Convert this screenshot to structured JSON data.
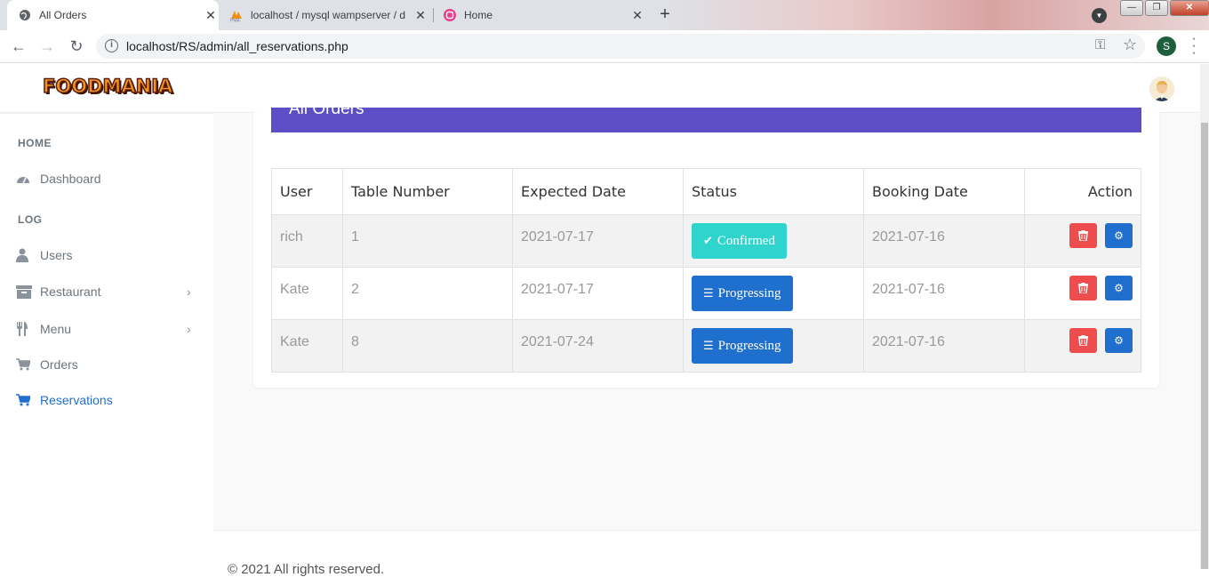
{
  "browser": {
    "tabs": [
      {
        "title": "All Orders",
        "active": true
      },
      {
        "title": "localhost / mysql wampserver / d",
        "active": false
      },
      {
        "title": "Home",
        "active": false
      }
    ],
    "url": "localhost/RS/admin/all_reservations.php",
    "profile_initial": "S"
  },
  "header": {
    "logo": "FOODMANIA"
  },
  "sidebar": {
    "sections": [
      "HOME",
      "LOG"
    ],
    "items": [
      {
        "label": "Dashboard",
        "icon": "dashboard-icon"
      },
      {
        "label": "Users",
        "icon": "user-icon"
      },
      {
        "label": "Restaurant",
        "icon": "archive-icon",
        "has_submenu": true
      },
      {
        "label": "Menu",
        "icon": "cutlery-icon",
        "has_submenu": true
      },
      {
        "label": "Orders",
        "icon": "cart-icon"
      },
      {
        "label": "Reservations",
        "icon": "cart-icon",
        "active": true
      }
    ]
  },
  "main": {
    "card_title": "All Orders",
    "table": {
      "headers": [
        "User",
        "Table Number",
        "Expected Date",
        "Status",
        "Booking Date",
        "Action"
      ],
      "rows": [
        {
          "user": "rich",
          "table_number": "1",
          "expected_date": "2021-07-17",
          "status": "Confirmed",
          "booking_date": "2021-07-16"
        },
        {
          "user": "Kate",
          "table_number": "2",
          "expected_date": "2021-07-17",
          "status": "Progressing",
          "booking_date": "2021-07-16"
        },
        {
          "user": "Kate",
          "table_number": "8",
          "expected_date": "2021-07-24",
          "status": "Progressing",
          "booking_date": "2021-07-16"
        }
      ]
    }
  },
  "footer": {
    "text": "© 2021 All rights reserved."
  },
  "colors": {
    "accent": "#5d4ec6",
    "primary": "#1f6fcf",
    "success": "#2fd5cd",
    "danger": "#ef4d4d"
  }
}
